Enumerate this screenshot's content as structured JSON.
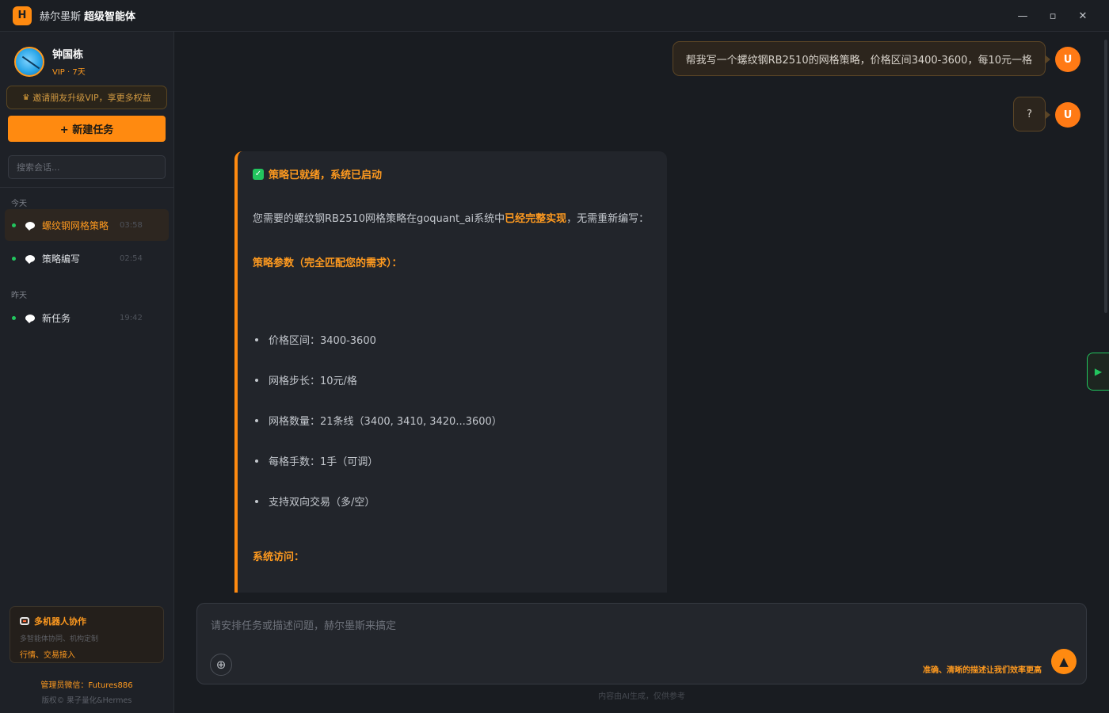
{
  "titlebar": {
    "logo": "H",
    "app_name": "赫尔墨斯",
    "app_name_bold": "超级智能体",
    "controls": {
      "minimize": "—",
      "maximize": "▫",
      "close": "✕"
    }
  },
  "sidebar": {
    "user": {
      "name": "钟国栋",
      "vip": "VIP · 7天"
    },
    "invite_label": "邀请朋友升级VIP，享更多权益",
    "new_task_label": "+ 新建任务",
    "search_placeholder": "搜索会话...",
    "groups": [
      {
        "label": "今天",
        "items": [
          {
            "title": "螺纹钢网格策略",
            "time": "03:58",
            "active": true
          },
          {
            "title": "策略编写",
            "time": "02:54",
            "active": false
          }
        ]
      },
      {
        "label": "昨天",
        "items": [
          {
            "title": "新任务",
            "time": "19:42",
            "active": false
          }
        ]
      }
    ],
    "multi_robot": {
      "title": "多机器人协作",
      "subtitle": "多智能体协同、机构定制",
      "link": "行情、交易接入"
    },
    "admin": "管理员微信：Futures886",
    "copyright": "版权© 果子量化&Hermes"
  },
  "chat": {
    "user_messages": [
      {
        "text": "帮我写一个螺纹钢RB2510的网格策略，价格区间3400-3600，每10元一格",
        "avatar": "U"
      },
      {
        "text": "?",
        "avatar": "U"
      }
    ],
    "ai": {
      "status_icon": "✓",
      "status": "策略已就绪，系统已启动",
      "intro_before": "您需要的螺纹钢RB2510网格策略在goquant_ai系统中",
      "intro_highlight": "已经完整实现",
      "intro_after": "，无需重新编写：",
      "params_title": "策略参数（完全匹配您的需求）：",
      "params": [
        "价格区间：3400-3600",
        "网格步长：10元/格",
        "网格数量：21条线（3400, 3410, 3420...3600）",
        "每格手数：1手（可调）",
        "支持双向交易（多/空）"
      ],
      "access_title": "系统访问："
    }
  },
  "input": {
    "placeholder": "请安排任务或描述问题，赫尔墨斯来搞定",
    "attach_icon": "⊕",
    "hint": "准确、清晰的描述让我们效率更高",
    "send_icon": "▲"
  },
  "disclaimer": "内容由AI生成，仅供参考",
  "side_toggle_icon": "▶",
  "colors": {
    "accent": "#ff8a10",
    "success": "#22c55e",
    "background": "#191c21"
  }
}
